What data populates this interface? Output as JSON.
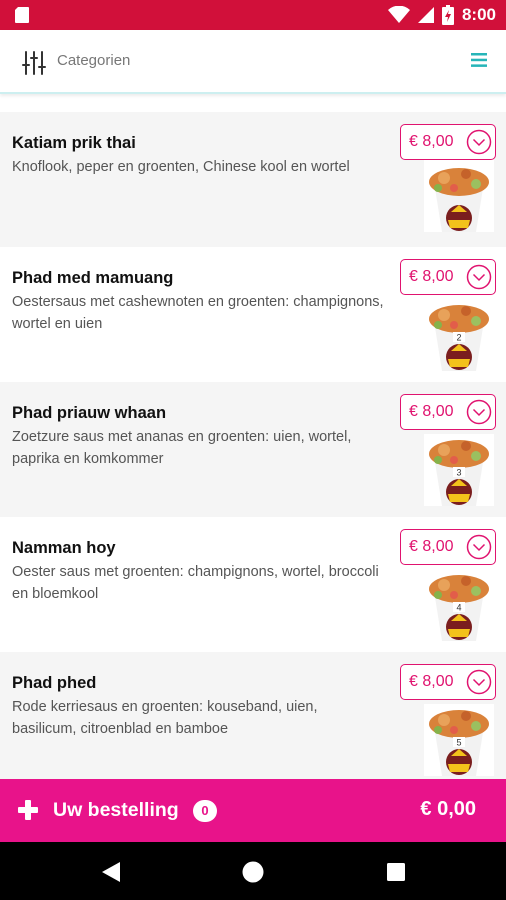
{
  "status_bar": {
    "time": "8:00",
    "background": "#d1103a"
  },
  "header": {
    "filter_icon": "sliders-icon",
    "title": "Categorien",
    "menu_icon": "hamburger-menu-icon"
  },
  "items": [
    {
      "name": "Katiam prik thai",
      "description": "Knoflook, peper en groenten, Chinese kool en wortel",
      "price": "€ 8,00"
    },
    {
      "name": "Phad med mamuang",
      "description": "Oestersaus met cashewnoten en groenten: champignons, wortel en uien",
      "price": "€ 8,00",
      "thumb_number": "2"
    },
    {
      "name": "Phad priauw whaan",
      "description": "Zoetzure saus met ananas en groenten: uien, wortel, paprika en komkommer",
      "price": "€ 8,00",
      "thumb_number": "3"
    },
    {
      "name": "Namman hoy",
      "description": "Oester saus met groenten: champignons, wortel, broccoli en bloemkool",
      "price": "€ 8,00",
      "thumb_number": "4"
    },
    {
      "name": "Phad phed",
      "description": "Rode kerriesaus en groenten: kouseband, uien, basilicum, citroenblad en bamboe",
      "price": "€ 8,00",
      "thumb_number": "5"
    }
  ],
  "order_bar": {
    "label": "Uw bestelling",
    "count": "0",
    "total": "€ 0,00",
    "background": "#e8138a"
  },
  "colors": {
    "accent": "#e0136f",
    "menu_icon": "#26b5b8"
  }
}
